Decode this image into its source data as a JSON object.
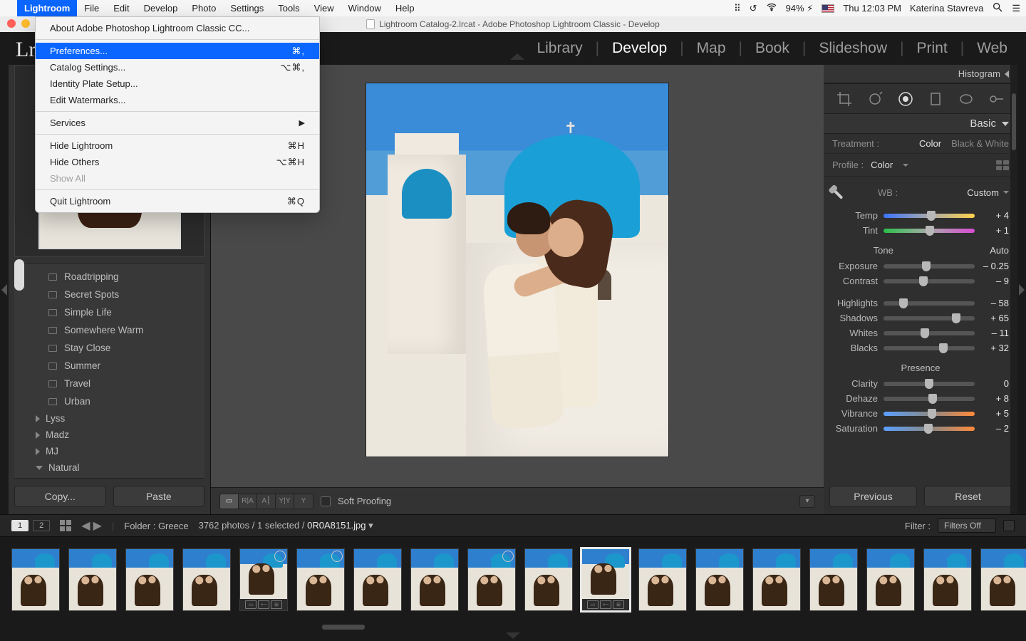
{
  "menubar": {
    "apple": "",
    "app": "Lightroom",
    "items": [
      "File",
      "Edit",
      "Develop",
      "Photo",
      "Settings",
      "Tools",
      "View",
      "Window",
      "Help"
    ],
    "battery": "94%",
    "clock": "Thu 12:03 PM",
    "user": "Katerina Stavreva"
  },
  "dropdown": {
    "about": "About Adobe Photoshop Lightroom Classic CC...",
    "prefs": "Preferences...",
    "prefs_short": "⌘,",
    "catalog": "Catalog Settings...",
    "catalog_short": "⌥⌘,",
    "identity": "Identity Plate Setup...",
    "watermarks": "Edit Watermarks...",
    "services": "Services",
    "hide": "Hide Lightroom",
    "hide_short": "⌘H",
    "hide_others": "Hide Others",
    "hide_others_short": "⌥⌘H",
    "show_all": "Show All",
    "quit": "Quit Lightroom",
    "quit_short": "⌘Q"
  },
  "window": {
    "title": "Lightroom Catalog-2.lrcat - Adobe Photoshop Lightroom Classic - Develop"
  },
  "header": {
    "logo": "Lr"
  },
  "modules": [
    "Library",
    "Develop",
    "Map",
    "Book",
    "Slideshow",
    "Print",
    "Web"
  ],
  "modules_active": "Develop",
  "left": {
    "collections": [
      "Roadtripping",
      "Secret Spots",
      "Simple Life",
      "Somewhere Warm",
      "Stay Close",
      "Summer",
      "Travel",
      "Urban"
    ],
    "folders": [
      {
        "name": "Lyss",
        "open": false
      },
      {
        "name": "Madz",
        "open": false
      },
      {
        "name": "MJ",
        "open": false
      },
      {
        "name": "Natural",
        "open": true
      }
    ],
    "copy": "Copy...",
    "paste": "Paste"
  },
  "center": {
    "view_modes": [
      "▭",
      "R|A",
      "A⎮",
      "Y|Y",
      "Y"
    ],
    "soft_proof": "Soft Proofing"
  },
  "right": {
    "histogram": "Histogram",
    "basic": "Basic",
    "treatment_label": "Treatment :",
    "treat_color": "Color",
    "treat_bw": "Black & White",
    "profile_label": "Profile :",
    "profile_value": "Color",
    "wb_label": "WB :",
    "wb_value": "Custom",
    "tone": "Tone",
    "auto": "Auto",
    "presence": "Presence",
    "sliders": {
      "temp": {
        "label": "Temp",
        "value": "+ 4",
        "pos": 52
      },
      "tint": {
        "label": "Tint",
        "value": "+ 1",
        "pos": 51
      },
      "exposure": {
        "label": "Exposure",
        "value": "– 0.25",
        "pos": 47
      },
      "contrast": {
        "label": "Contrast",
        "value": "– 9",
        "pos": 44
      },
      "highlights": {
        "label": "Highlights",
        "value": "– 58",
        "pos": 22
      },
      "shadows": {
        "label": "Shadows",
        "value": "+ 65",
        "pos": 80
      },
      "whites": {
        "label": "Whites",
        "value": "– 11",
        "pos": 45
      },
      "blacks": {
        "label": "Blacks",
        "value": "+ 32",
        "pos": 66
      },
      "clarity": {
        "label": "Clarity",
        "value": "0",
        "pos": 50
      },
      "dehaze": {
        "label": "Dehaze",
        "value": "+ 8",
        "pos": 54
      },
      "vibrance": {
        "label": "Vibrance",
        "value": "+ 5",
        "pos": 53
      },
      "saturation": {
        "label": "Saturation",
        "value": "– 2",
        "pos": 49
      }
    },
    "previous": "Previous",
    "reset": "Reset"
  },
  "footer": {
    "pages": [
      "1",
      "2"
    ],
    "folder_label": "Folder : Greece",
    "count": "3762 photos / 1 selected /",
    "filename": "0R0A8151.jpg",
    "filter_label": "Filter :",
    "filter_value": "Filters Off"
  }
}
